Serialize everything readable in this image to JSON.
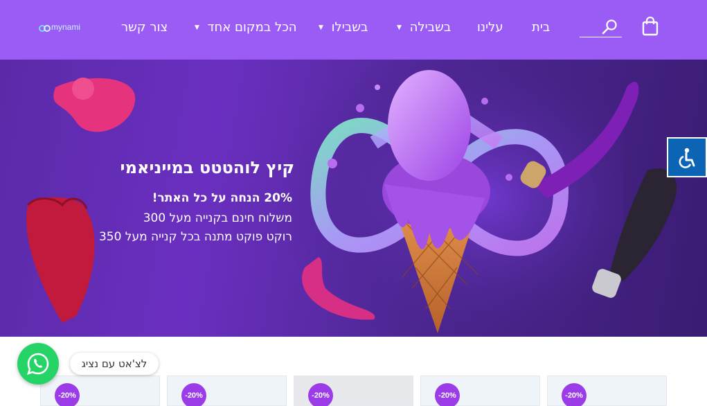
{
  "header": {
    "background": "#9b5cf6",
    "logo_text": "mynami",
    "nav": [
      {
        "label": "בית",
        "has_dropdown": false
      },
      {
        "label": "עלינו",
        "has_dropdown": false
      },
      {
        "label": "בשבילה",
        "has_dropdown": true
      },
      {
        "label": "בשבילו",
        "has_dropdown": true
      },
      {
        "label": "הכל במקום אחד",
        "has_dropdown": true
      },
      {
        "label": "צור קשר",
        "has_dropdown": false
      }
    ],
    "icons": {
      "cart": "shopping-bag-icon",
      "search": "search-icon",
      "dropdown": "chevron-down-icon"
    }
  },
  "hero": {
    "title": "קיץ לוהטטט במייניאמי",
    "lines": [
      "20% הנחה על כל האתר!",
      "משלוח חינם בקנייה מעל 300",
      "רוקט פוקט מתנה בכל קנייה מעל 350"
    ]
  },
  "accessibility": {
    "icon": "wheelchair-icon",
    "color": "#0c64b5"
  },
  "products": {
    "badge_color": "#9b3ce8",
    "cards": [
      {
        "badge": "-20%"
      },
      {
        "badge": "-20%"
      },
      {
        "badge": "-20%"
      },
      {
        "badge": "-20%"
      },
      {
        "badge": "-20%"
      }
    ]
  },
  "whatsapp": {
    "label": "לצ'אט עם נציג",
    "icon": "whatsapp-icon",
    "color": "#25d366"
  }
}
